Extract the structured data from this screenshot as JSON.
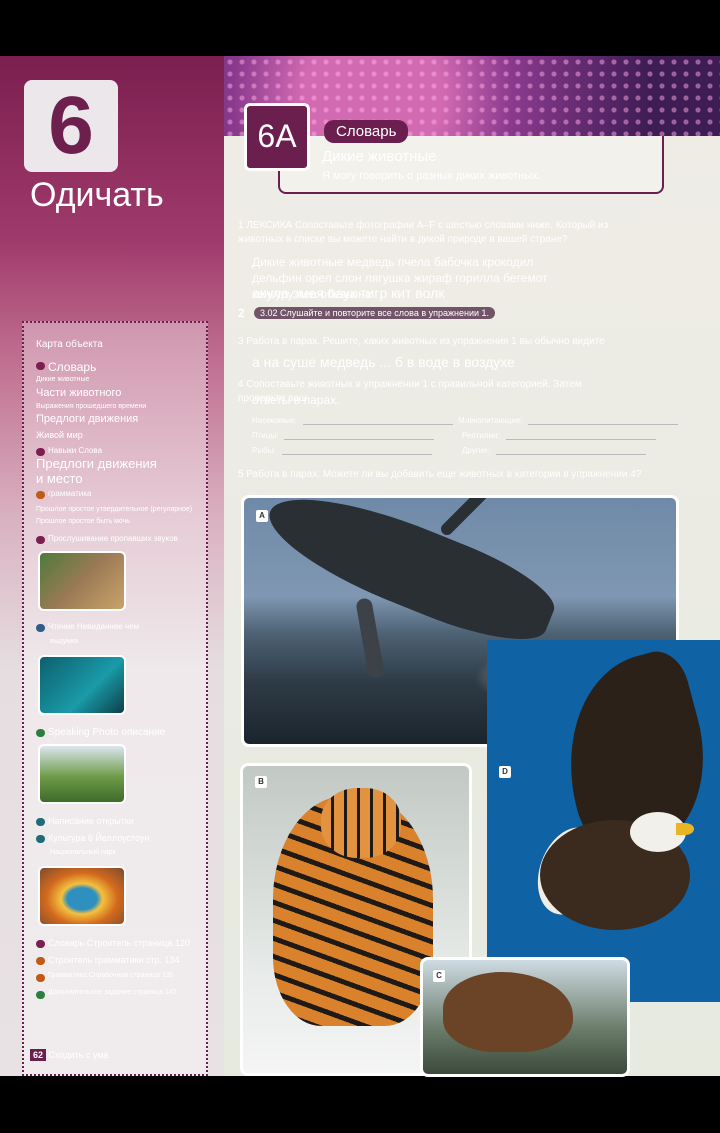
{
  "unit": {
    "number": "6",
    "title": "Одичать"
  },
  "lesson": {
    "code": "6A",
    "tag": "Словарь",
    "title": "Дикие животные",
    "goal": "Я могу говорить о разных диких животных."
  },
  "exercise1": {
    "text": "1 ЛЕКСИКА Сопоставьте фотографии A–F с шестью словами ниже. Который из животных в списке вы можете найти в дикой природе в вашей стране?",
    "words": "Дикие животные медведь пчела бабочка крокодил дельфин орел слон лягушка жираф горилла бегемот кенгуру лев обезьяна",
    "words2": "акула змея паук тигр кит волк"
  },
  "exercise2": {
    "num": "2",
    "audio": "3.02 Слушайте и повторите все слова в упражнении 1."
  },
  "exercise3": {
    "text": "3 Работа в парах. Решите, каких животных из упражнения 1 вы обычно видите",
    "answer": "а на суше медведь ... б в воде в воздухе"
  },
  "exercise4": {
    "text": "4 Сопоставьте животных в упражнении 1 с правильной категорией. Затем проверьте ваш",
    "text2": "ответы в парах."
  },
  "categories": [
    {
      "label": "Насекомые:"
    },
    {
      "label": "Млекопитающие:"
    },
    {
      "label": "Птицы:"
    },
    {
      "label": "Рептилии:"
    },
    {
      "label": "Рыбы:"
    },
    {
      "label": "Другие:"
    }
  ],
  "exercise5": {
    "text": "5 Работа в парах. Можете ли вы добавить еще животных в категории в упражнении 4?"
  },
  "photos": {
    "a": "A",
    "b": "B",
    "c": "C",
    "d": "D"
  },
  "sidebar": {
    "title": "Карта объекта",
    "vocab": "Словарь",
    "wild": "Дикие животные",
    "body": "Части животного",
    "tenses": "Выражения прошедшего времени",
    "prep": "Предлоги движения",
    "wildworld": "Живой мир",
    "skills": "Навыки Слова",
    "prep2": "Предлоги движения\nи место",
    "grammar": "грамматика",
    "g1": "Прошлое простое утвердительное (регулярное)",
    "g2": "Прошлое простое быть мочь",
    "listening": "Прослушивание пропавших звуков",
    "reading": "Чтение Невиданнее чем",
    "reading2": "выдумка",
    "speaking": "Speaking Photo описание",
    "writing": "Написание открытки",
    "culture": "Культура 6 Йеллоустоун",
    "culture2": "Национальный парк",
    "ref1": "Словарь Строитель страница 120",
    "ref2": "Строитель грамматики стр. 134",
    "ref3": "Грамматика Справочная страница 135",
    "ref4": "Дополнительное задание страница 142"
  },
  "footer": {
    "page": "62",
    "text": "Сходить с ума"
  }
}
